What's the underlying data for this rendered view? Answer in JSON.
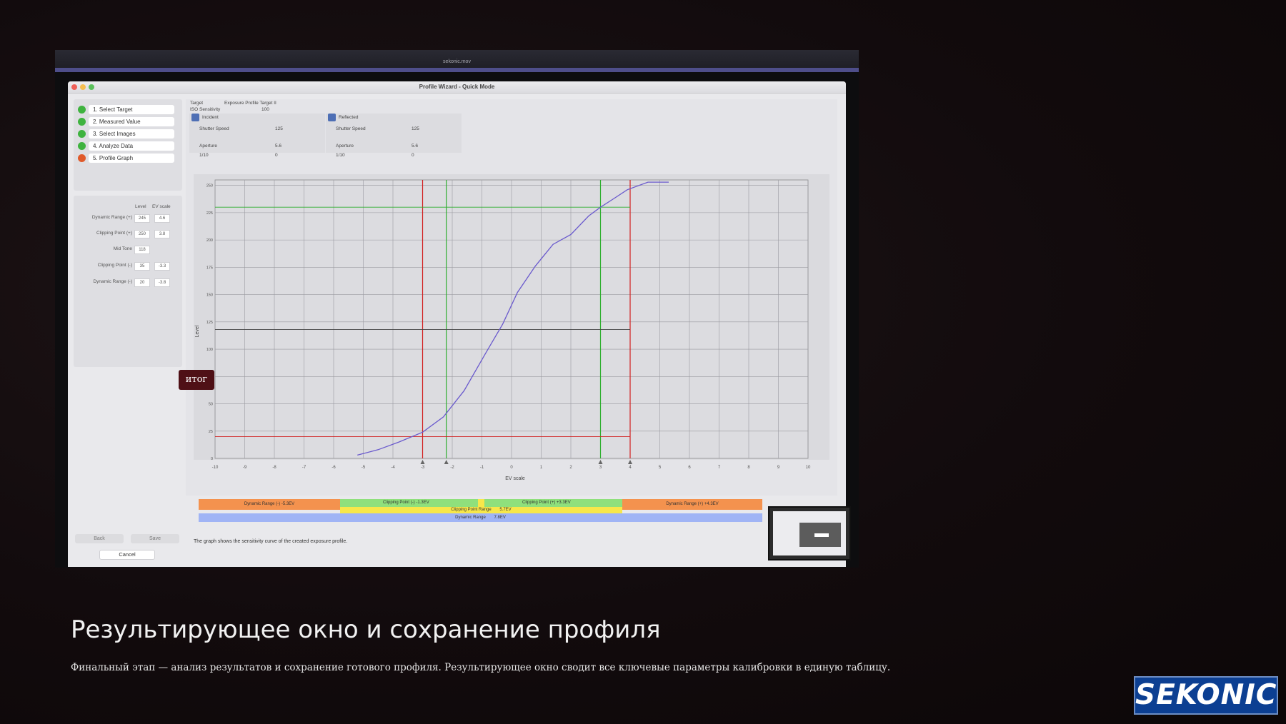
{
  "video": {
    "title": "sekonic.mov"
  },
  "window": {
    "title": "Profile Wizard - Quick Mode"
  },
  "steps": [
    {
      "label": "1. Select Target",
      "status_color": "#3fb33f"
    },
    {
      "label": "2. Measured Value",
      "status_color": "#3fb33f"
    },
    {
      "label": "3. Select Images",
      "status_color": "#3fb33f"
    },
    {
      "label": "4. Analyze Data",
      "status_color": "#3fb33f"
    },
    {
      "label": "5. Profile Graph",
      "status_color": "#e05a2a"
    }
  ],
  "values": {
    "col_level": "Level",
    "col_ev": "EV scale",
    "rows": [
      {
        "label": "Dynamic Range (+)",
        "level": "245",
        "ev": "4.6"
      },
      {
        "label": "Clipping Point (+)",
        "level": "250",
        "ev": "3.8"
      },
      {
        "label": "Mid Tone",
        "level": "118",
        "ev": ""
      },
      {
        "label": "Clipping Point (-)",
        "level": "35",
        "ev": "-3.3"
      },
      {
        "label": "Dynamic Range (-)",
        "level": "20",
        "ev": "-3.8"
      }
    ]
  },
  "buttons": {
    "back": "Back",
    "save": "Save",
    "cancel": "Cancel"
  },
  "target": {
    "label": "Target",
    "value": "Exposure Profile Target II",
    "iso_label": "ISO Sensitivity",
    "iso_value": "100"
  },
  "meters": {
    "incident": {
      "title": "Incident",
      "shutter_label": "Shutter Speed",
      "shutter_value": "125",
      "aperture_label": "Aperture",
      "aperture_value": "5.6",
      "tenths_label": "1/10",
      "tenths_value": "0"
    },
    "reflected": {
      "title": "Reflected",
      "shutter_label": "Shutter Speed",
      "shutter_value": "125",
      "aperture_label": "Aperture",
      "aperture_value": "5.6",
      "tenths_label": "1/10",
      "tenths_value": "0"
    }
  },
  "legend": {
    "dr_minus": "Dynamic Range (-) -5.3EV",
    "cp_minus": "Clipping Point (-) -1.3EV",
    "cp_plus": "Clipping Point (+) +3.3EV",
    "dr_plus": "Dynamic Range (+) +4.3EV",
    "clip_range_label": "Clipping Point Range",
    "clip_range_value": "5.7EV",
    "dyn_range_label": "Dynamic Range",
    "dyn_range_value": "7.8EV"
  },
  "caption": "The graph shows the sensitivity curve of the created exposure profile.",
  "overlay": {
    "itog": "итог"
  },
  "slide": {
    "headline": "Результирующее окно и сохранение профиля",
    "description": "Финальный этап — анализ результатов и сохранение готового профиля. Результирующее окно сводит все ключевые параметры калибровки в единую таблицу."
  },
  "logo": {
    "text": "SEKONIC",
    "color": "#0c3f92"
  },
  "chart_data": {
    "type": "line",
    "xlabel": "EV scale",
    "ylabel": "Level",
    "xlim": [
      -10,
      10
    ],
    "ylim": [
      0,
      255
    ],
    "x_ticks": [
      -10,
      -9,
      -8,
      -7,
      -6,
      -5,
      -4,
      -3,
      -2,
      -1,
      0,
      1,
      2,
      3,
      4,
      5,
      6,
      7,
      8,
      9,
      10
    ],
    "y_ticks": [
      0,
      25,
      50,
      75,
      100,
      125,
      150,
      175,
      200,
      225,
      250
    ],
    "grid": true,
    "series": [
      {
        "color": "#6a5acd",
        "x": [
          -5.2,
          -4.5,
          -3.8,
          -3.0,
          -2.3,
          -1.6,
          -0.9,
          -0.3,
          0.2,
          0.8,
          1.4,
          2.0,
          2.6,
          3.0,
          3.4,
          3.9,
          4.6,
          5.3
        ],
        "y": [
          3,
          8,
          15,
          24,
          38,
          62,
          95,
          123,
          152,
          176,
          196,
          205,
          222,
          230,
          237,
          246,
          253,
          253
        ]
      }
    ],
    "vertical_markers": [
      {
        "x": -3.0,
        "color": "#d22020"
      },
      {
        "x": -2.2,
        "color": "#2eae2e"
      },
      {
        "x": 3.0,
        "color": "#2eae2e"
      },
      {
        "x": 4.0,
        "color": "#d22020"
      }
    ],
    "horizontal_markers": [
      {
        "y": 20,
        "color": "#d22020"
      },
      {
        "y": 230,
        "color": "#2eae2e"
      },
      {
        "y": 118,
        "color": "#444444"
      }
    ]
  }
}
